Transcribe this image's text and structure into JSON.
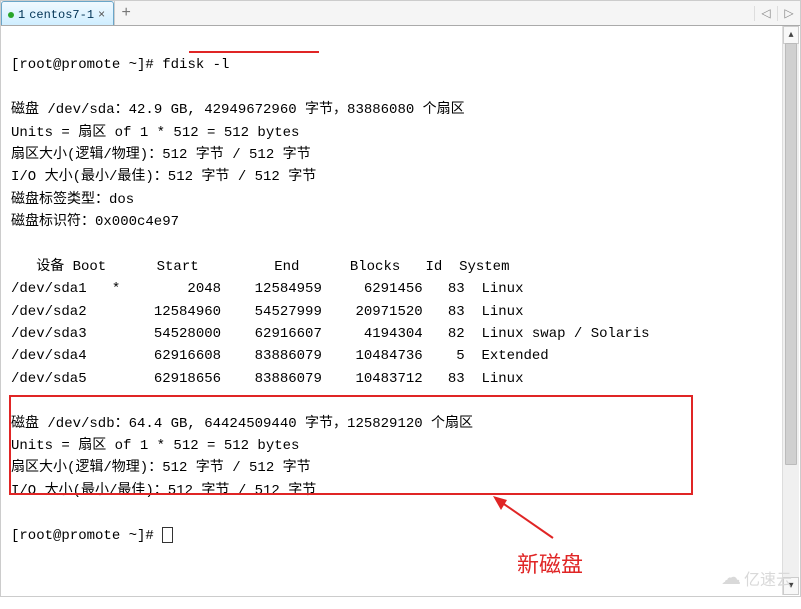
{
  "tab": {
    "index": "1",
    "title": "centos7-1"
  },
  "prompt": "[root@promote ~]#",
  "command": "fdisk -l",
  "sda": {
    "header": "磁盘 /dev/sda：42.9 GB, 42949672960 字节，83886080 个扇区",
    "units": "Units = 扇区 of 1 * 512 = 512 bytes",
    "sector": "扇区大小(逻辑/物理)：512 字节 / 512 字节",
    "io": "I/O 大小(最小/最佳)：512 字节 / 512 字节",
    "labeltype": "磁盘标签类型：dos",
    "identifier": "磁盘标识符：0x000c4e97"
  },
  "table_header": "   设备 Boot      Start         End      Blocks   Id  System",
  "partitions": [
    "/dev/sda1   *        2048    12584959     6291456   83  Linux",
    "/dev/sda2        12584960    54527999    20971520   83  Linux",
    "/dev/sda3        54528000    62916607     4194304   82  Linux swap / Solaris",
    "/dev/sda4        62916608    83886079    10484736    5  Extended",
    "/dev/sda5        62918656    83886079    10483712   83  Linux"
  ],
  "sdb": {
    "header": "磁盘 /dev/sdb：64.4 GB, 64424509440 字节，125829120 个扇区",
    "units": "Units = 扇区 of 1 * 512 = 512 bytes",
    "sector": "扇区大小(逻辑/物理)：512 字节 / 512 字节",
    "io": "I/O 大小(最小/最佳)：512 字节 / 512 字节"
  },
  "annotation": "新磁盘",
  "watermark": "亿速云"
}
